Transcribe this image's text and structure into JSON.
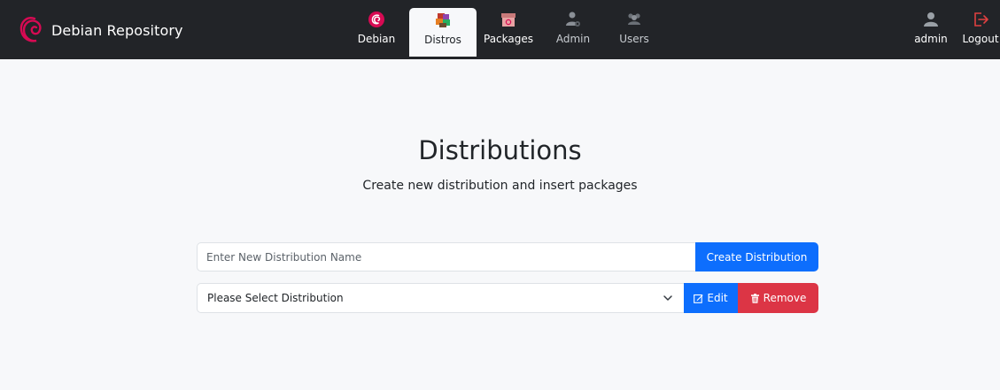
{
  "navbar": {
    "brand": {
      "label": "Debian Repository",
      "icon": "debian-swirl-icon"
    },
    "items": [
      {
        "label": "Debian",
        "icon": "debian-logo-icon",
        "active": false
      },
      {
        "label": "Distros",
        "icon": "distros-boxes-icon",
        "active": true
      },
      {
        "label": "Packages",
        "icon": "package-box-icon",
        "active": false
      },
      {
        "label": "Admin",
        "icon": "admin-user-gear-icon",
        "active": false
      },
      {
        "label": "Users",
        "icon": "users-group-icon",
        "active": false
      }
    ],
    "user": {
      "label": "admin",
      "icon": "user-icon"
    },
    "logout": {
      "label": "Logout",
      "icon": "logout-icon"
    }
  },
  "page": {
    "title": "Distributions",
    "subtitle": "Create new distribution and insert packages"
  },
  "create_form": {
    "placeholder": "Enter New Distribution Name",
    "value": "",
    "button_label": "Create Distribution"
  },
  "select_form": {
    "selected": "Please Select Distribution",
    "edit_label": "Edit",
    "remove_label": "Remove"
  },
  "colors": {
    "navbar_bg": "#222428",
    "page_bg": "#f7f8fa",
    "primary": "#0d6efd",
    "danger": "#dc3545",
    "debian_red": "#d70a53",
    "logout_red": "#e04040"
  }
}
